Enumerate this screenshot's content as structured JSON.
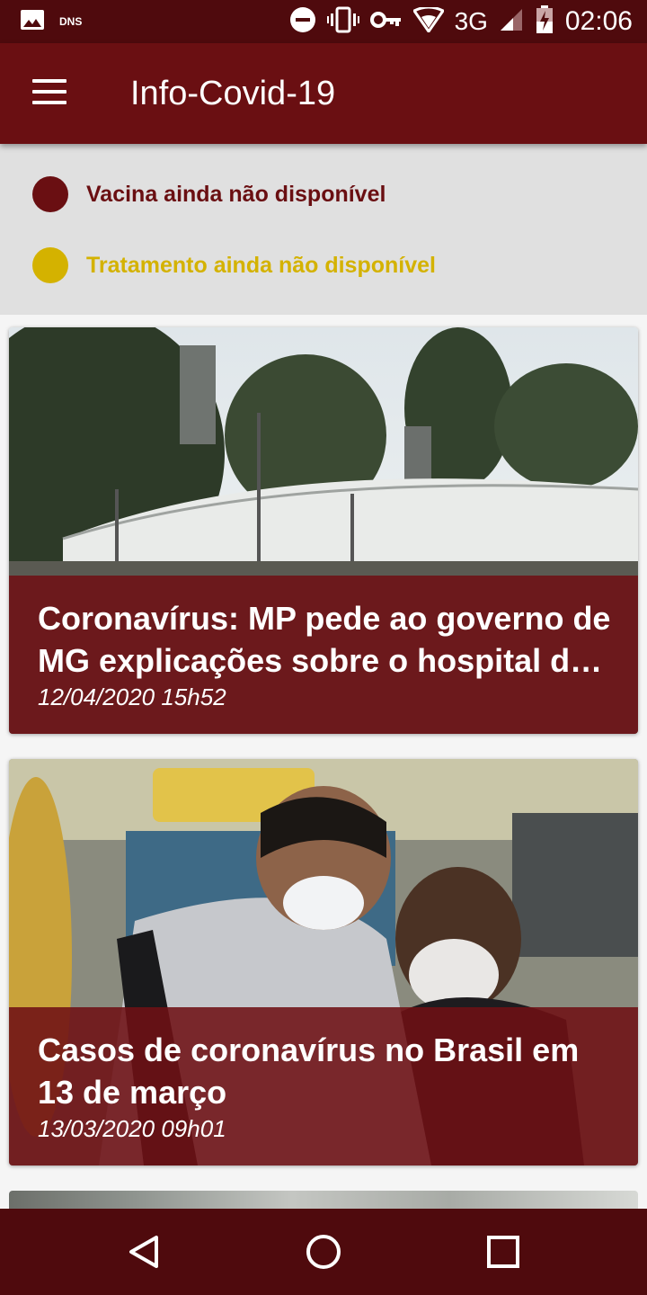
{
  "status_bar": {
    "left_icons": [
      "image-icon"
    ],
    "dns_label": "DNS",
    "network": "3G",
    "time": "02:06",
    "right_icons": [
      "do-not-disturb-icon",
      "vibrate-icon",
      "vpn-key-icon",
      "wifi-icon",
      "signal-icon",
      "battery-charging-icon"
    ]
  },
  "app_bar": {
    "menu_icon": "menu-icon",
    "title": "Info-Covid-19"
  },
  "status_panel": {
    "items": [
      {
        "label": "Vacina ainda não disponível",
        "color": "#6a0f12"
      },
      {
        "label": "Tratamento ainda não disponível",
        "color": "#d4b200"
      }
    ]
  },
  "news": [
    {
      "title": "Coronavírus: MP pede ao governo de MG explicações sobre o hospital de campanha",
      "date": "12/04/2020 15h52"
    },
    {
      "title": "Casos de coronavírus no Brasil em 13 de março",
      "date": "13/03/2020 09h01"
    }
  ],
  "nav_bar": {
    "buttons": [
      "back-icon",
      "home-icon",
      "recents-icon"
    ]
  },
  "colors": {
    "primary": "#6a0f12",
    "primary_dark": "#4f0a0d",
    "accent_yellow": "#d4b200"
  }
}
